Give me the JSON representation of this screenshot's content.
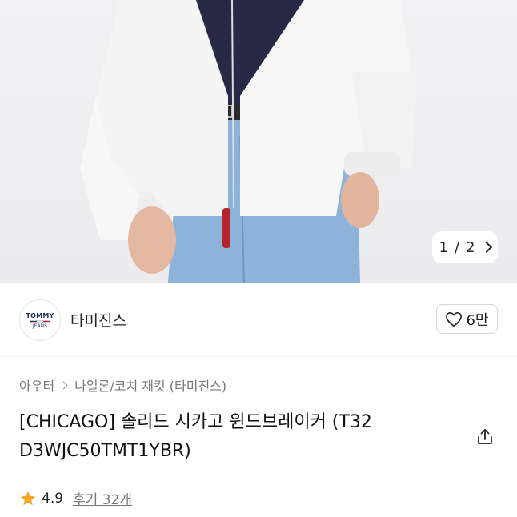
{
  "gallery": {
    "current": "1",
    "separator": "/",
    "total": "2"
  },
  "brand": {
    "logo_line1": "TOMMY",
    "logo_line2": "JEANS",
    "name": "타미진스",
    "likes": "6만"
  },
  "breadcrumb": {
    "parent": "아우터",
    "child": "나일론/코치 재킷 (타미진스)"
  },
  "product": {
    "title": "[CHICAGO] 솔리드 시카고 윈드브레이커 (T32 D3WJC50TMT1YBR)"
  },
  "rating": {
    "score": "4.9",
    "reviews": "후기 32개"
  },
  "colors": {
    "star": "#f5a623",
    "heart": "#222222"
  }
}
